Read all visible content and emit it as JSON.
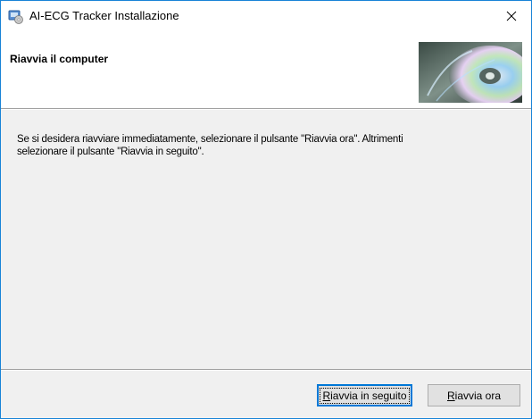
{
  "window": {
    "title": "AI-ECG Tracker Installazione",
    "close_glyph": "✕"
  },
  "header": {
    "title": "Riavvia il computer",
    "graphic": "cd-disc-graphic"
  },
  "body": {
    "line1": "Se si desidera riavviare immediatamente, selezionare il pulsante \"Riavvia ora\". Altrimenti",
    "line2": "selezionare il pulsante \"Riavvia in seguito\"."
  },
  "buttons": {
    "later": {
      "label_first": "R",
      "label_rest": "iavvia in seguito",
      "focused": true
    },
    "now": {
      "label_first": "R",
      "label_rest": "iavvia ora"
    }
  },
  "icons": {
    "app": "installer-icon",
    "close": "close-icon"
  },
  "colors": {
    "window_border": "#1883d7",
    "focus_border": "#0078d7",
    "dialog_bg": "#f0f0f0",
    "button_bg": "#e1e1e1"
  }
}
